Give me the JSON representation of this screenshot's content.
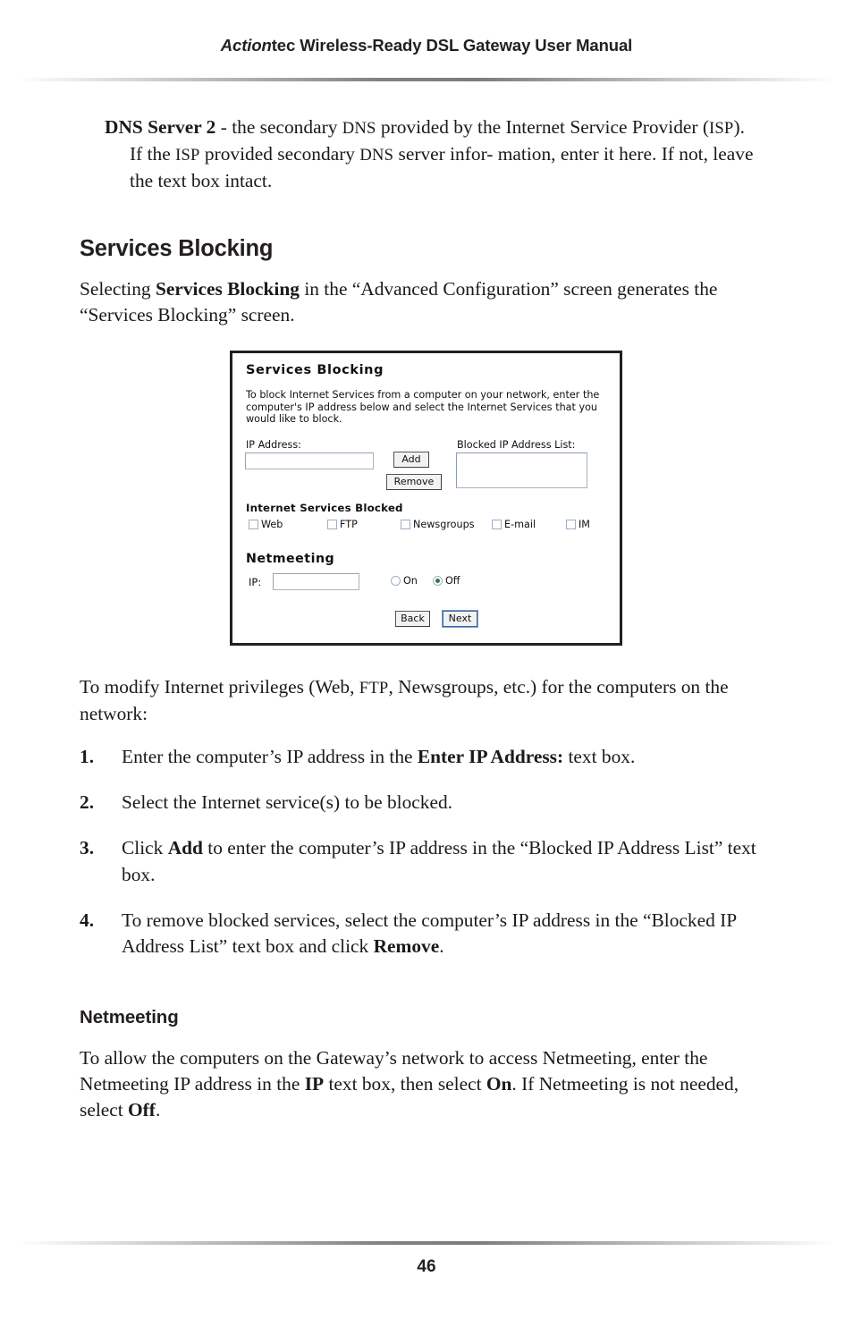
{
  "header": {
    "brand": "Action",
    "title_rest": "tec Wireless-Ready DSL Gateway User Manual"
  },
  "definition": {
    "term": "DNS Server 2",
    "line1_rest": " - the secondary ",
    "dns_sc_1": "DNS",
    "line1_tail": " provided by the Internet Service",
    "line2_a": "Provider (",
    "isp_sc_1": "ISP",
    "line2_b": "). If the ",
    "isp_sc_2": "ISP",
    "line2_c": " provided secondary ",
    "dns_sc_2": "DNS",
    "line2_d": " server infor-",
    "line3": "mation, enter it here. If not, leave the text box intact."
  },
  "section": {
    "title": "Services Blocking",
    "intro_a": "Selecting ",
    "intro_bold": "Services Blocking",
    "intro_b": " in the “Advanced Configuration” screen generates the “Services Blocking” screen."
  },
  "figure": {
    "title": "Services Blocking",
    "description": "To block Internet Services from a computer on your network, enter the computer's IP address below and select the Internet Services that you would like to block.",
    "ip_address_label": "IP Address:",
    "ip_address_value": "",
    "blocked_list_label": "Blocked IP Address List:",
    "blocked_list_items": [],
    "add_button": "Add",
    "remove_button": "Remove",
    "services_heading": "Internet Services Blocked",
    "services": [
      {
        "label": "Web",
        "checked": false
      },
      {
        "label": "FTP",
        "checked": false
      },
      {
        "label": "Newsgroups",
        "checked": false
      },
      {
        "label": "E-mail",
        "checked": false
      },
      {
        "label": "IM",
        "checked": false
      }
    ],
    "netmeeting_heading": "Netmeeting",
    "netmeeting_ip_label": "IP:",
    "netmeeting_ip_value": "",
    "radio_on_label": "On",
    "radio_off_label": "Off",
    "radio_selected": "Off",
    "back_button": "Back",
    "next_button": "Next"
  },
  "after_figure": {
    "text_a": "To modify Internet privileges (Web, ",
    "ftp_sc": "FTP",
    "text_b": ", Newsgroups, etc.) for the computers on the network:"
  },
  "steps": [
    {
      "num": "1.",
      "text_a": "Enter the computer’s IP address in the ",
      "bold": "Enter IP Address:",
      "text_b": " text box."
    },
    {
      "num": "2.",
      "text_a": "Select the Internet service(s) to be blocked.",
      "bold": "",
      "text_b": ""
    },
    {
      "num": "3.",
      "text_a": "Click ",
      "bold": "Add",
      "text_b": " to enter the computer’s IP address in the “Blocked IP Address List” text box."
    },
    {
      "num": "4.",
      "text_a": "To remove blocked services, select the computer’s IP address in the “Blocked IP Address List” text box and click ",
      "bold": "Remove",
      "text_b": "."
    }
  ],
  "netmeeting_section": {
    "title": "Netmeeting",
    "text_a": "To allow the computers on the Gateway’s network to access Netmeeting, enter the Netmeeting IP address in the ",
    "bold_ip": "IP",
    "text_b": " text box, then select ",
    "bold_on": "On",
    "text_c": ". If Netmeeting is not needed, select ",
    "bold_off": "Off",
    "text_d": "."
  },
  "footer": {
    "page_number": "46"
  },
  "colors": {
    "text": "#1a1a1a",
    "heading": "#231f20",
    "figure_border": "#231f20",
    "field_border": "#a8b4c4",
    "radio_selected_dot": "#2e7a3c",
    "focus_ring": "#7d9cc4"
  }
}
